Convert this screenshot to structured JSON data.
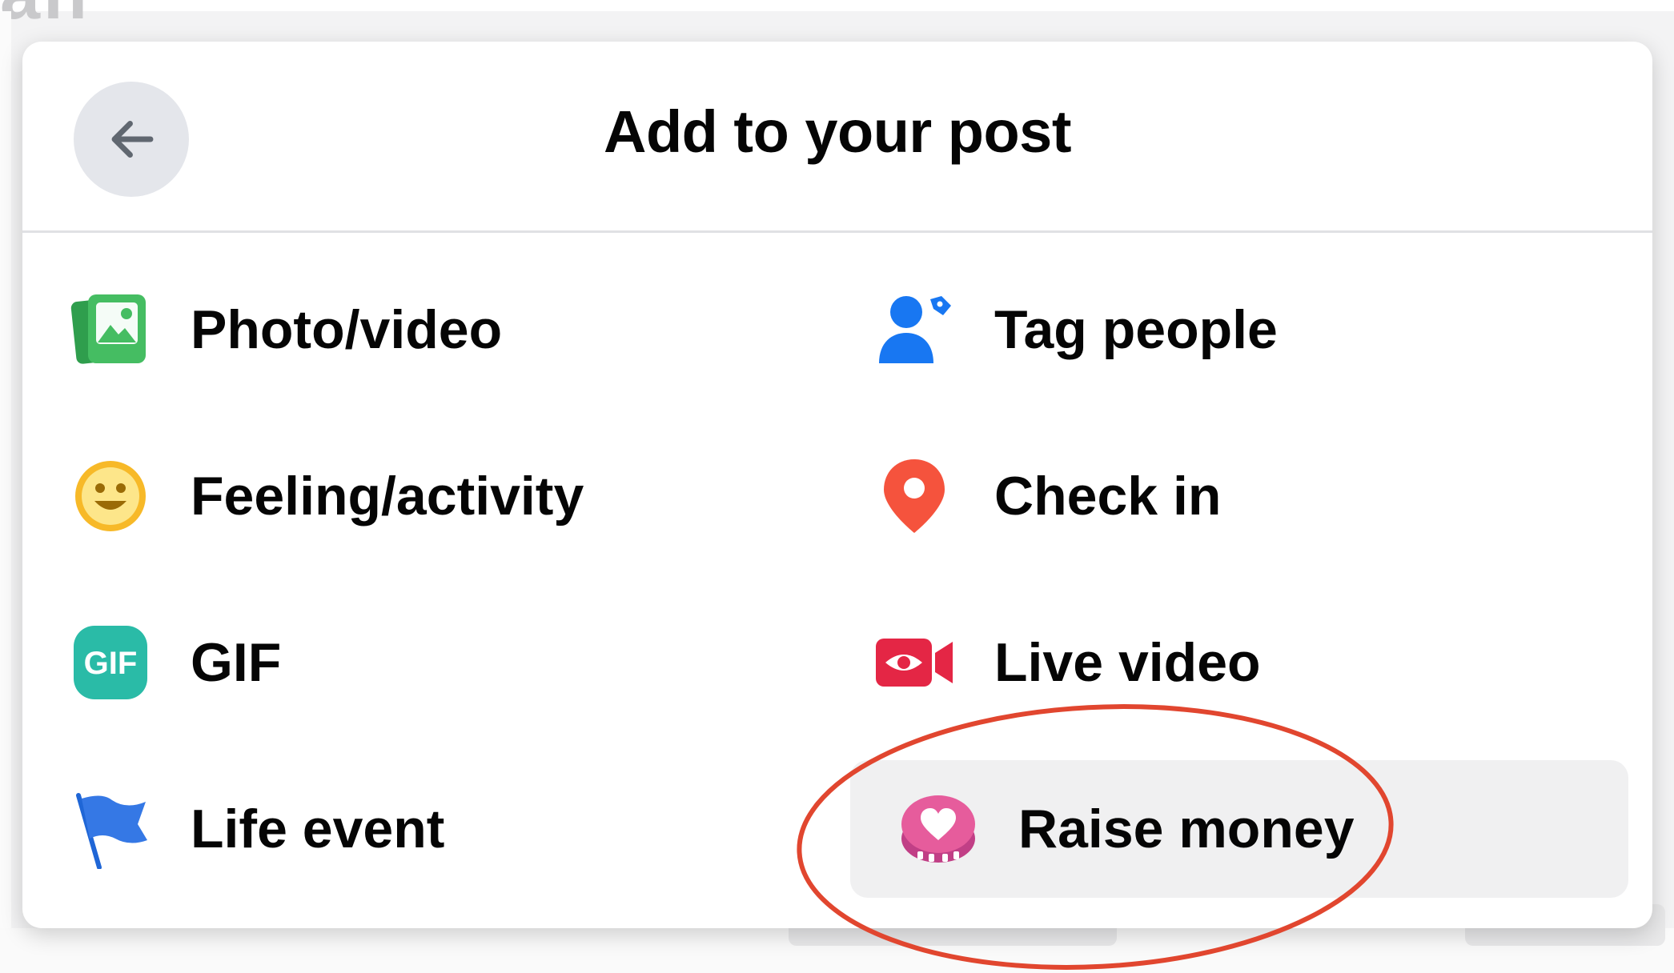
{
  "background": {
    "ghost_text": "an"
  },
  "dialog": {
    "title": "Add to your post",
    "back_icon": "arrow-left-icon"
  },
  "options": [
    {
      "label": "Photo/video",
      "icon": "photo-video-icon",
      "color": "#45bd62"
    },
    {
      "label": "Tag people",
      "icon": "tag-people-icon",
      "color": "#1877f2"
    },
    {
      "label": "Feeling/activity",
      "icon": "feeling-icon",
      "color": "#f7b928"
    },
    {
      "label": "Check in",
      "icon": "check-in-icon",
      "color": "#f5533d"
    },
    {
      "label": "GIF",
      "icon": "gif-icon",
      "color": "#2abba7"
    },
    {
      "label": "Live video",
      "icon": "live-video-icon",
      "color": "#e42645"
    },
    {
      "label": "Life event",
      "icon": "life-event-icon",
      "color": "#3578e5"
    },
    {
      "label": "Raise money",
      "icon": "raise-money-icon",
      "color": "#e65c9c",
      "highlighted": true
    }
  ],
  "annotation": {
    "type": "ellipse",
    "color": "#e1462f",
    "target": "Raise money"
  }
}
